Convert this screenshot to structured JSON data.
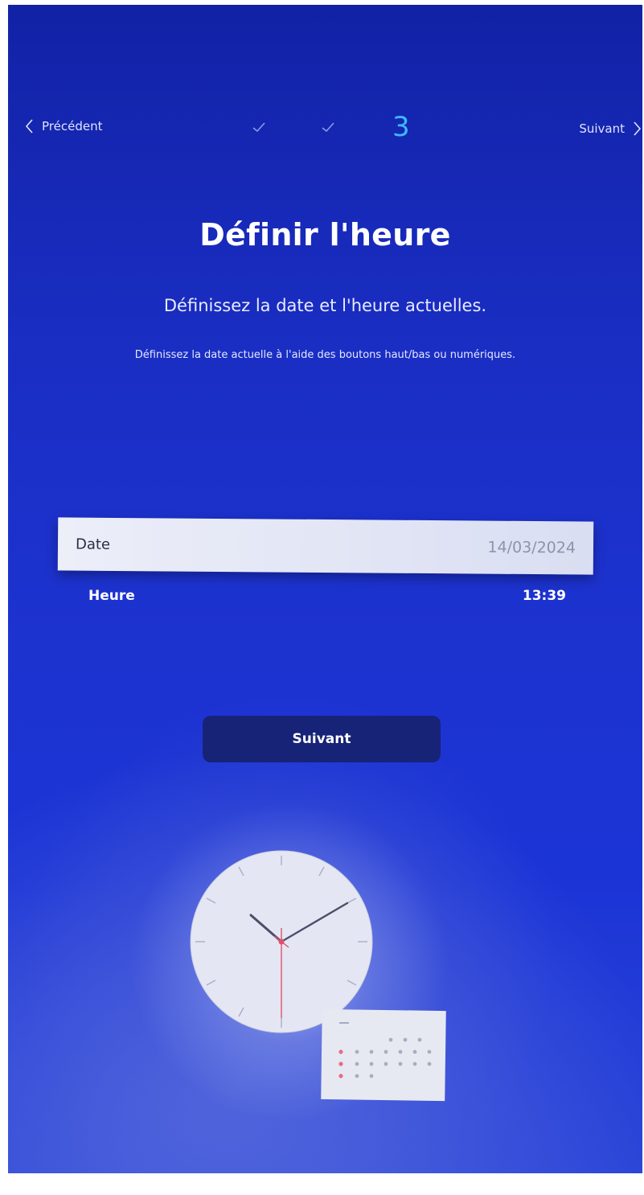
{
  "nav": {
    "prev_label": "Précédent",
    "next_label": "Suivant",
    "current_step": "3",
    "completed_steps": 2
  },
  "header": {
    "title": "Définir l'heure",
    "subtitle": "Définissez la date et l'heure actuelles.",
    "hint": "Définissez la date actuelle à l'aide des boutons haut/bas ou numériques."
  },
  "settings": {
    "date_label": "Date",
    "date_value": "14/03/2024",
    "time_label": "Heure",
    "time_value": "13:39"
  },
  "actions": {
    "next_button": "Suivant"
  },
  "illustration": {
    "clock_icon": "clock-icon",
    "calendar_icon": "calendar-icon"
  },
  "colors": {
    "background": "#1b34d6",
    "step_accent": "#3fb8ff",
    "button": "#172377",
    "focus_row": "#e3e6f5"
  }
}
